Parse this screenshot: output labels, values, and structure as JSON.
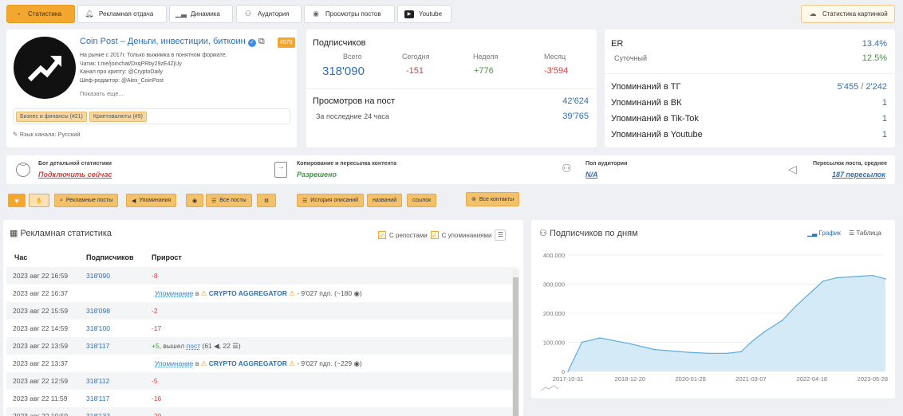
{
  "tabs": [
    {
      "label": "Статистика",
      "icon": "chart-circle-icon"
    },
    {
      "label": "Рекламная отдача",
      "icon": "bell-icon"
    },
    {
      "label": "Динамика",
      "icon": "bar-chart-icon"
    },
    {
      "label": "Аудитория",
      "icon": "users-icon"
    },
    {
      "label": "Просмотры постов",
      "icon": "eye-icon"
    },
    {
      "label": "Youtube",
      "icon": "youtube-icon"
    }
  ],
  "stats_image_button": "Статистика картинкой",
  "channel": {
    "name": "Coin Post – Деньги, инвестиции, биткоин",
    "rank": "#575",
    "lines": [
      "На рынке с 2017г. Только выжимка в понятном формате.",
      "Чатик: t.me/joinchat/DxqPRby29zE4ZjUy",
      "Канал про крипту: @CryptoDaily",
      "Шеф-редактор: @Alex_CoinPost"
    ],
    "show_more": "Показать еще...",
    "categories": [
      "Бизнес и финансы (#21)",
      "Криптовалюты (#9)"
    ],
    "language": "Язык канала: Русский"
  },
  "subscribers": {
    "title": "Подписчиков",
    "cols": [
      {
        "label": "Всего",
        "value": "318'090"
      },
      {
        "label": "Сегодня",
        "value": "-151"
      },
      {
        "label": "Неделя",
        "value": "+776"
      },
      {
        "label": "Месяц",
        "value": "-3'594"
      }
    ],
    "views_label": "Просмотров на пост",
    "views_value": "42'624",
    "last24_label": "За последние 24 часа",
    "last24_value": "39'765"
  },
  "metrics": {
    "er_label": "ER",
    "er_value": "13.4%",
    "daily_label": "Суточный",
    "daily_value": "12.5%",
    "tg_label": "Упоминаний в ТГ",
    "tg_value_a": "5'455",
    "tg_sep": "/",
    "tg_value_b": "2'242",
    "vk_label": "Упоминаний в ВК",
    "vk_value": "1",
    "tiktok_label": "Упоминаний в Tik-Tok",
    "tiktok_value": "1",
    "yt_label": "Упоминаний в Youtube",
    "yt_value": "1"
  },
  "info": {
    "bot_title": "Бот детальной статистики",
    "bot_link": "Подключить сейчас",
    "copy_title": "Копирование и пересылка контента",
    "copy_value": "Разрешено",
    "gender_title": "Пол аудитории",
    "gender_value": "N/A",
    "forward_title": "Пересылок поста, среднее",
    "forward_value": "187 пересылок"
  },
  "toolbar": {
    "ad_posts": "Рекламные посты",
    "mentions": "Упоминания",
    "all_posts": "Все посты",
    "history": "История описаний",
    "names": "названий",
    "links": "ссылок",
    "contacts": "Все контакты"
  },
  "ad_stats": {
    "title": "Рекламная статистика",
    "with_reposts": "С репостами",
    "with_mentions": "С упоминаниями",
    "headers": [
      "Час",
      "Подписчиков",
      "Прирост"
    ],
    "rows": [
      {
        "time": "2023 авг 22 16:59",
        "subs": "318'090",
        "gain": "-8",
        "type": "neg"
      },
      {
        "time": "2023 авг 22 16:37",
        "subs": "",
        "gain": "",
        "type": "mention",
        "mention": "Упоминание",
        "in": "в",
        "channel": "CRYPTO AGGREGATOR",
        "tail": "- 9'027 пдп. (~180"
      },
      {
        "time": "2023 авг 22 15:59",
        "subs": "318'098",
        "gain": "-2",
        "type": "neg"
      },
      {
        "time": "2023 авг 22 14:59",
        "subs": "318'100",
        "gain": "-17",
        "type": "neg"
      },
      {
        "time": "2023 авг 22 13:59",
        "subs": "318'117",
        "gain": "+5",
        "type": "pos",
        "extra": ", вышел",
        "post": "пост",
        "tail": "(61",
        "tail2": ", 22"
      },
      {
        "time": "2023 авг 22 13:37",
        "subs": "",
        "gain": "",
        "type": "mention",
        "mention": "Упоминание",
        "in": "в",
        "channel": "CRYPTO AGGREGATOR",
        "tail": "- 9'027 пдп. (~229"
      },
      {
        "time": "2023 авг 22 12:59",
        "subs": "318'112",
        "gain": "-5",
        "type": "neg"
      },
      {
        "time": "2023 авг 22 11:59",
        "subs": "318'117",
        "gain": "-16",
        "type": "neg"
      },
      {
        "time": "2023 авг 22 10:59",
        "subs": "318'133",
        "gain": "-20",
        "type": "neg"
      }
    ]
  },
  "chart_panel": {
    "title": "Подписчиков по дням",
    "graph_tab": "График",
    "table_tab": "Таблица"
  },
  "colors": {
    "accent": "#f3a72f",
    "link": "#2f6fb6",
    "negative": "#e03a3a",
    "positive": "#3d9b3d",
    "area": "#bfe0f3",
    "line": "#5aaee0"
  },
  "chart_data": {
    "type": "area",
    "x": [
      "2017-10-31",
      "2018-02-01",
      "2018-06-01",
      "2018-12-20",
      "2019-06-01",
      "2020-01-28",
      "2020-06-01",
      "2020-10-01",
      "2021-01-01",
      "2021-03-07",
      "2021-06-01",
      "2021-10-01",
      "2022-01-01",
      "2022-04-18",
      "2022-07-01",
      "2022-10-01",
      "2023-01-01",
      "2023-03-01",
      "2023-05-28",
      "2023-08-22"
    ],
    "values": [
      0,
      100000,
      115000,
      95000,
      75000,
      65000,
      62000,
      62000,
      68000,
      100000,
      135000,
      175000,
      225000,
      275000,
      310000,
      322000,
      325000,
      327000,
      330000,
      318090
    ],
    "ylim": [
      0,
      400000
    ],
    "yticks": [
      "0",
      "100,000",
      "200,000",
      "300,000",
      "400,000"
    ],
    "xticks": [
      "2017-10-31",
      "2018-12-20",
      "2020-01-28",
      "2021-03-07",
      "2022-04-18",
      "2023-05-28"
    ]
  }
}
